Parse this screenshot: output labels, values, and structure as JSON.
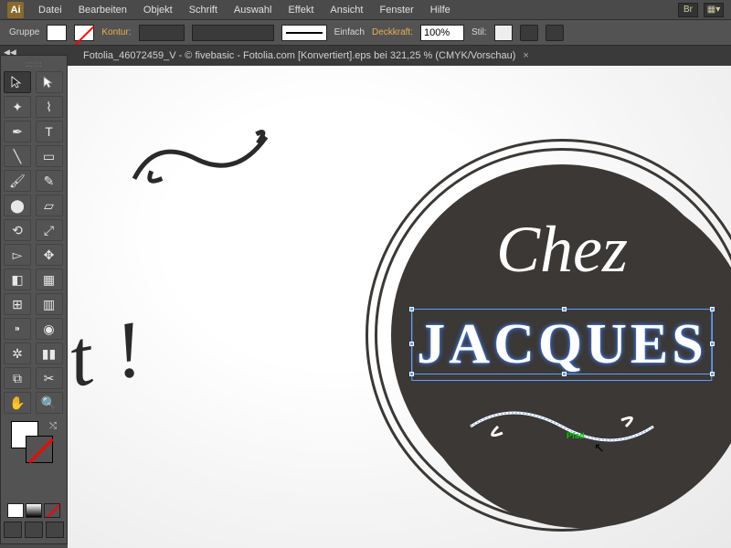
{
  "app": {
    "id": "Ai"
  },
  "menu": [
    "Datei",
    "Bearbeiten",
    "Objekt",
    "Schrift",
    "Auswahl",
    "Effekt",
    "Ansicht",
    "Fenster",
    "Hilfe"
  ],
  "menubar_right": {
    "br": "Br"
  },
  "control": {
    "group_label": "Gruppe",
    "stroke_label": "Kontur:",
    "stroke_style_label": "Einfach",
    "opacity_label": "Deckkraft:",
    "opacity_value": "100%",
    "style_label": "Stil:"
  },
  "document": {
    "tab_title": "Fotolia_46072459_V - © fivebasic - Fotolia.com [Konvertiert].eps bei 321,25 % (CMYK/Vorschau)"
  },
  "tools": [
    [
      "selection",
      "direct-selection"
    ],
    [
      "wand",
      "lasso"
    ],
    [
      "pen",
      "type"
    ],
    [
      "line",
      "rectangle"
    ],
    [
      "brush",
      "pencil"
    ],
    [
      "blob",
      "eraser"
    ],
    [
      "rotate",
      "scale"
    ],
    [
      "width",
      "warp"
    ],
    [
      "shape-builder",
      "perspective"
    ],
    [
      "mesh",
      "gradient"
    ],
    [
      "eyedropper",
      "blend"
    ],
    [
      "spray",
      "graph"
    ],
    [
      "artboard",
      "slice"
    ],
    [
      "hand",
      "zoom"
    ]
  ],
  "artwork": {
    "left_text": "n\ntit !",
    "badge_top": "Chez",
    "badge_main": "JACQUES",
    "hint": "Pfad"
  }
}
